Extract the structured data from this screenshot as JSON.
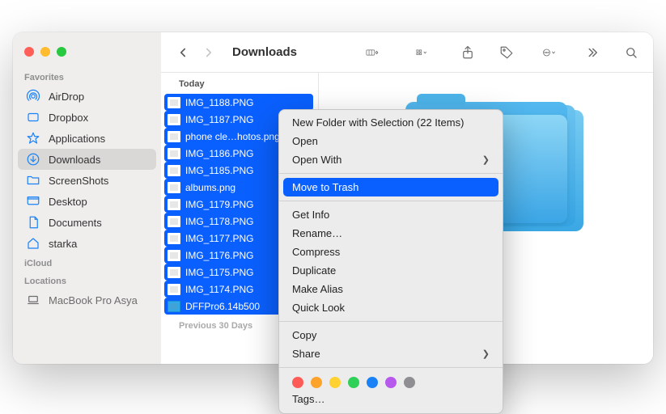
{
  "window": {
    "title": "Downloads"
  },
  "sidebar": {
    "sections": [
      {
        "label": "Favorites",
        "items": [
          {
            "label": "AirDrop",
            "icon": "airdrop-icon",
            "active": false
          },
          {
            "label": "Dropbox",
            "icon": "dropbox-icon",
            "active": false
          },
          {
            "label": "Applications",
            "icon": "applications-icon",
            "active": false
          },
          {
            "label": "Downloads",
            "icon": "downloads-icon",
            "active": true
          },
          {
            "label": "ScreenShots",
            "icon": "folder-icon",
            "active": false
          },
          {
            "label": "Desktop",
            "icon": "desktop-icon",
            "active": false
          },
          {
            "label": "Documents",
            "icon": "documents-icon",
            "active": false
          },
          {
            "label": "starka",
            "icon": "home-icon",
            "active": false
          }
        ]
      },
      {
        "label": "iCloud",
        "items": []
      },
      {
        "label": "Locations",
        "items": [
          {
            "label": "MacBook Pro Asya",
            "icon": "laptop-icon",
            "active": false
          }
        ]
      }
    ]
  },
  "file_list": {
    "section_header": "Today",
    "section_tail": "Previous 30 Days",
    "items": [
      {
        "label": "IMG_1188.PNG",
        "selected": true,
        "kind": "image"
      },
      {
        "label": "IMG_1187.PNG",
        "selected": true,
        "kind": "image"
      },
      {
        "label": "phone cle…hotos.png",
        "selected": true,
        "kind": "image"
      },
      {
        "label": "IMG_1186.PNG",
        "selected": true,
        "kind": "image"
      },
      {
        "label": "IMG_1185.PNG",
        "selected": true,
        "kind": "image"
      },
      {
        "label": "albums.png",
        "selected": true,
        "kind": "image"
      },
      {
        "label": "IMG_1179.PNG",
        "selected": true,
        "kind": "image"
      },
      {
        "label": "IMG_1178.PNG",
        "selected": true,
        "kind": "image"
      },
      {
        "label": "IMG_1177.PNG",
        "selected": true,
        "kind": "image"
      },
      {
        "label": "IMG_1176.PNG",
        "selected": true,
        "kind": "image"
      },
      {
        "label": "IMG_1175.PNG",
        "selected": true,
        "kind": "image"
      },
      {
        "label": "IMG_1174.PNG",
        "selected": true,
        "kind": "image"
      },
      {
        "label": "DFFPro6.14b500",
        "selected": true,
        "kind": "folder"
      }
    ]
  },
  "context_menu": {
    "groups": [
      [
        {
          "label": "New Folder with Selection (22 Items)",
          "submenu": false,
          "highlighted": false
        },
        {
          "label": "Open",
          "submenu": false,
          "highlighted": false
        },
        {
          "label": "Open With",
          "submenu": true,
          "highlighted": false
        }
      ],
      [
        {
          "label": "Move to Trash",
          "submenu": false,
          "highlighted": true
        }
      ],
      [
        {
          "label": "Get Info",
          "submenu": false,
          "highlighted": false
        },
        {
          "label": "Rename…",
          "submenu": false,
          "highlighted": false
        },
        {
          "label": "Compress",
          "submenu": false,
          "highlighted": false
        },
        {
          "label": "Duplicate",
          "submenu": false,
          "highlighted": false
        },
        {
          "label": "Make Alias",
          "submenu": false,
          "highlighted": false
        },
        {
          "label": "Quick Look",
          "submenu": false,
          "highlighted": false
        }
      ],
      [
        {
          "label": "Copy",
          "submenu": false,
          "highlighted": false
        },
        {
          "label": "Share",
          "submenu": true,
          "highlighted": false
        }
      ]
    ],
    "tags": {
      "colors": [
        "#ff5b56",
        "#fda32a",
        "#ffd232",
        "#2fd057",
        "#1a82f7",
        "#b659ec",
        "#8e8e93"
      ],
      "label": "Tags…"
    }
  },
  "toolbar": {
    "back_disabled": false
  }
}
